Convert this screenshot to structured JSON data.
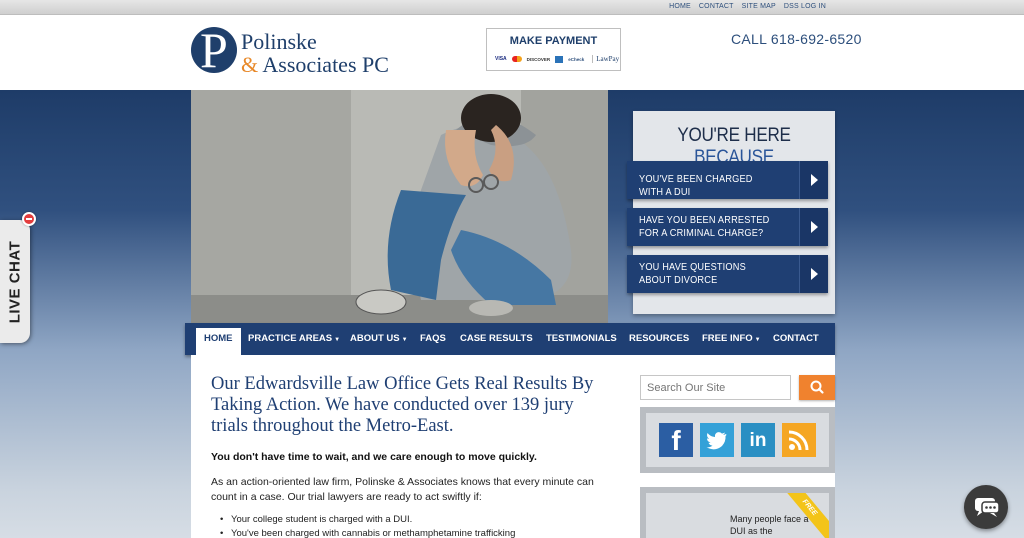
{
  "topbar": {
    "links": [
      "HOME",
      "CONTACT",
      "SITE MAP",
      "DSS LOG IN"
    ]
  },
  "header": {
    "logo_mark": "P",
    "logo_line1": "Polinske",
    "logo_amp": "&",
    "logo_line2": "Associates PC",
    "payment_title": "MAKE PAYMENT",
    "payment_cards": [
      "VISA",
      "mastercard",
      "DISCOVER",
      "amex",
      "eCheck"
    ],
    "payment_brand": "LawPay",
    "call_text": "CALL 618-692-6520"
  },
  "because": {
    "title_main": "YOU'RE HERE",
    "title_accent": "BECAUSE",
    "items": [
      {
        "label": "YOU'VE BEEN CHARGED WITH A DUI"
      },
      {
        "label": "HAVE YOU BEEN ARRESTED FOR A CRIMINAL CHARGE?"
      },
      {
        "label": "YOU HAVE QUESTIONS ABOUT DIVORCE"
      }
    ]
  },
  "nav": {
    "items": [
      {
        "label": "HOME",
        "active": true,
        "dropdown": false
      },
      {
        "label": "PRACTICE AREAS",
        "active": false,
        "dropdown": true
      },
      {
        "label": "ABOUT US",
        "active": false,
        "dropdown": true
      },
      {
        "label": "FAQS",
        "active": false,
        "dropdown": false
      },
      {
        "label": "CASE RESULTS",
        "active": false,
        "dropdown": false
      },
      {
        "label": "TESTIMONIALS",
        "active": false,
        "dropdown": false
      },
      {
        "label": "RESOURCES",
        "active": false,
        "dropdown": false
      },
      {
        "label": "FREE INFO",
        "active": false,
        "dropdown": true
      },
      {
        "label": "CONTACT",
        "active": false,
        "dropdown": false
      }
    ]
  },
  "content": {
    "headline": "Our Edwardsville Law Office Gets Real Results By Taking Action. We have conducted over 139 jury trials throughout the Metro-East.",
    "lead": "You don't have time to wait, and we care enough to move quickly.",
    "paragraph": "As an action-oriented law firm, Polinske & Associates knows that every minute can count in a case. Our trial lawyers are ready to act swiftly if:",
    "bullets": [
      "Your college student is charged with a DUI.",
      "You've been charged with cannabis or methamphetamine trafficking"
    ]
  },
  "sidebar": {
    "search_placeholder": "Search Our Site",
    "social_icons": [
      "facebook-icon",
      "twitter-icon",
      "linkedin-icon",
      "rss-icon"
    ],
    "free_ribbon": "FREE",
    "free_text": "Many people face a DUI as the"
  },
  "live_chat": {
    "label": "LIVE CHAT"
  },
  "colors": {
    "navy": "#1f3f73",
    "accent_blue": "#2a5599",
    "orange": "#f0822e",
    "gold": "#f3c419"
  }
}
